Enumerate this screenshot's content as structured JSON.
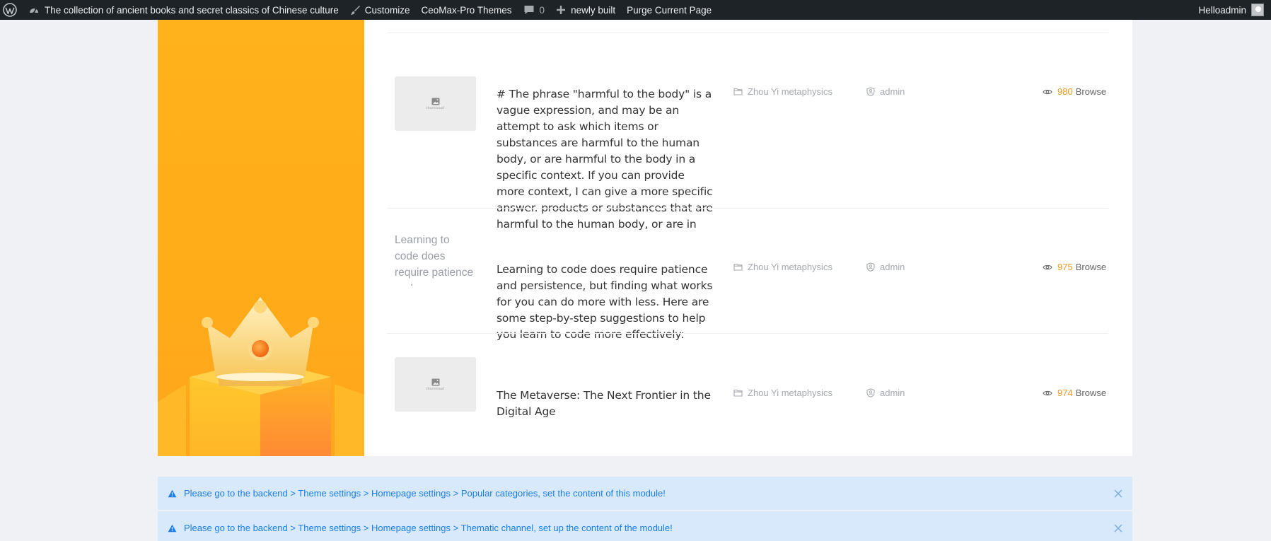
{
  "adminbar": {
    "site_title": "The collection of ancient books and secret classics of Chinese culture",
    "customize": "Customize",
    "themes": "CeoMax-Pro Themes",
    "comments_count": "0",
    "new": "newly built",
    "purge": "Purge Current Page",
    "greeting": "Helloadmin"
  },
  "posts": [
    {
      "thumbnail": "thumbnail",
      "title": "# The phrase \"harmful to the body\" is a vague expression, and may be an attempt to ask which items or substances are harmful to the human body, or are harmful to the body in a specific context. If you can provide more context, I can give a more specific answer. products or substances that are harmful to the human body, or are in",
      "category": "Zhou Yi metaphysics",
      "author": "admin",
      "views": "980",
      "views_label": "Browse"
    },
    {
      "thumbnail_alt": "Learning to code does require patience and",
      "title": "Learning to code does require patience and persistence, but finding what works for you can do more with less. Here are some step-by-step suggestions to help you learn to code more effectively:",
      "category": "Zhou Yi metaphysics",
      "author": "admin",
      "views": "975",
      "views_label": "Browse"
    },
    {
      "thumbnail": "thumbnail",
      "title": "The Metaverse: The Next Frontier in the Digital Age",
      "category": "Zhou Yi metaphysics",
      "author": "admin",
      "views": "974",
      "views_label": "Browse"
    }
  ],
  "notices": [
    "Please go to the backend > Theme settings > Homepage settings > Popular categories, set the content of this module!",
    "Please go to the backend > Theme settings > Homepage settings > Thematic channel, set up the content of the module!"
  ],
  "colors": {
    "adminbar_bg": "#1d2327",
    "banner": "#ffac18",
    "views_number": "#f59a23",
    "notice_bg": "#d8e9fb",
    "notice_text": "#1a7ee6"
  },
  "icons": {
    "wordpress": "wordpress-logo-icon",
    "dashboard": "dashboard-icon",
    "customize": "paintbrush-icon",
    "comments": "comment-icon",
    "new": "plus-icon",
    "category": "folder-icon",
    "author": "user-shield-icon",
    "views": "eye-icon",
    "notice": "warning-icon",
    "close": "close-icon"
  }
}
